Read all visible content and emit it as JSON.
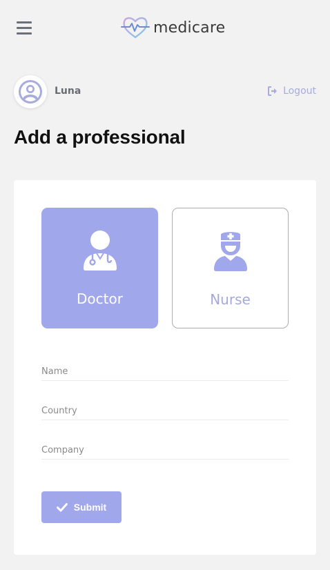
{
  "header": {
    "menu_icon": "hamburger-icon",
    "brand": "medicare",
    "brand_icon": "heart-pulse-icon"
  },
  "user": {
    "name": "Luna",
    "avatar_icon": "user-circle-icon",
    "logout_label": "Logout",
    "logout_icon": "sign-out-icon"
  },
  "page": {
    "title": "Add a professional"
  },
  "form": {
    "types": [
      {
        "label": "Doctor",
        "icon": "doctor-icon",
        "selected": true
      },
      {
        "label": "Nurse",
        "icon": "nurse-icon",
        "selected": false
      }
    ],
    "fields": {
      "name": {
        "placeholder": "Name",
        "value": ""
      },
      "country": {
        "placeholder": "Country",
        "value": ""
      },
      "company": {
        "placeholder": "Company",
        "value": ""
      }
    },
    "submit_label": "Submit",
    "submit_icon": "check-icon"
  },
  "colors": {
    "accent": "#a0a7eb",
    "accent_text": "#a4a9db",
    "background": "#f2f2f2"
  }
}
